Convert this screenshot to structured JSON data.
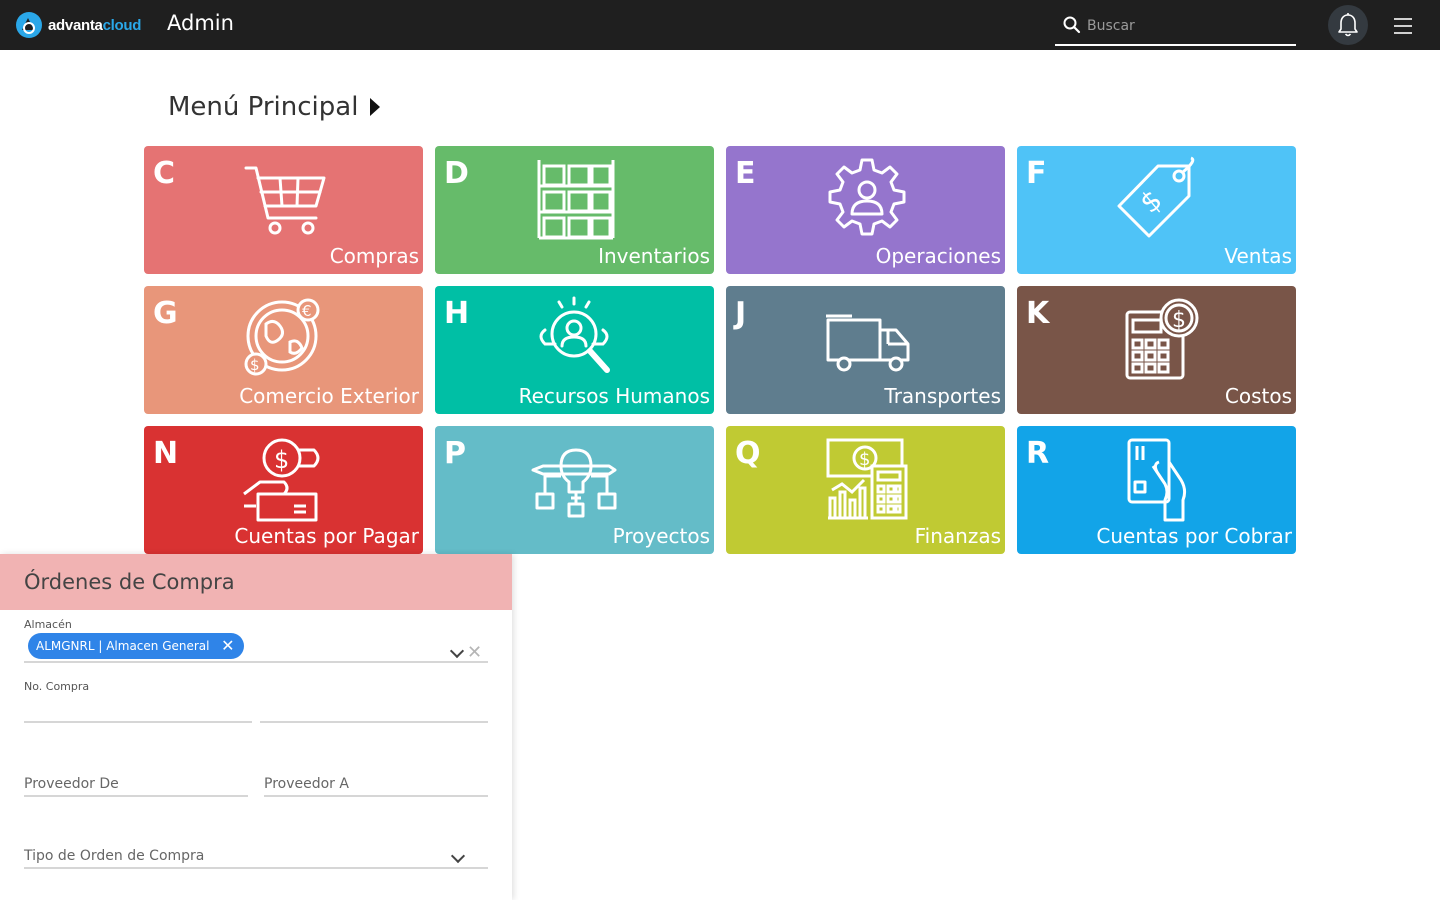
{
  "header": {
    "logo_word_a": "advanta",
    "logo_word_b": "cloud",
    "title": "Admin",
    "search_placeholder": "Buscar",
    "colors": {
      "bar": "#1f1f1f",
      "accent": "#2aa7e8"
    }
  },
  "menu": {
    "title": "Menú Principal",
    "tiles": [
      {
        "letter": "C",
        "label": "Compras",
        "color": "#e57373",
        "icon": "shopping-cart-icon"
      },
      {
        "letter": "D",
        "label": "Inventarios",
        "color": "#66bb6a",
        "icon": "warehouse-boxes-icon"
      },
      {
        "letter": "E",
        "label": "Operaciones",
        "color": "#9575cd",
        "icon": "gear-person-icon"
      },
      {
        "letter": "F",
        "label": "Ventas",
        "color": "#4fc3f7",
        "icon": "price-tag-icon"
      },
      {
        "letter": "G",
        "label": "Comercio Exterior",
        "color": "#e8967a",
        "icon": "globe-currency-icon"
      },
      {
        "letter": "H",
        "label": "Recursos Humanos",
        "color": "#00bfa5",
        "icon": "person-search-icon"
      },
      {
        "letter": "J",
        "label": "Transportes",
        "color": "#5f7d8e",
        "icon": "truck-icon"
      },
      {
        "letter": "K",
        "label": "Costos",
        "color": "#795548",
        "icon": "calculator-coin-icon"
      },
      {
        "letter": "N",
        "label": "Cuentas por Pagar",
        "color": "#d93232",
        "icon": "hand-coin-icon"
      },
      {
        "letter": "P",
        "label": "Proyectos",
        "color": "#64bcc8",
        "icon": "lightbulb-project-icon"
      },
      {
        "letter": "Q",
        "label": "Finanzas",
        "color": "#c0ca33",
        "icon": "finance-calculator-icon"
      },
      {
        "letter": "R",
        "label": "Cuentas por Cobrar",
        "color": "#12a4e8",
        "icon": "hand-card-icon"
      }
    ]
  },
  "panel": {
    "title": "Órdenes de Compra",
    "almacen_label": "Almacén",
    "almacen_chip": "ALMGNRL | Almacen General",
    "no_compra_label": "No. Compra",
    "proveedor_de": "Proveedor De",
    "proveedor_a": "Proveedor A",
    "tipo_orden": "Tipo de Orden de Compra",
    "header_color": "#f1b3b3",
    "chip_color": "#2f84e8"
  }
}
